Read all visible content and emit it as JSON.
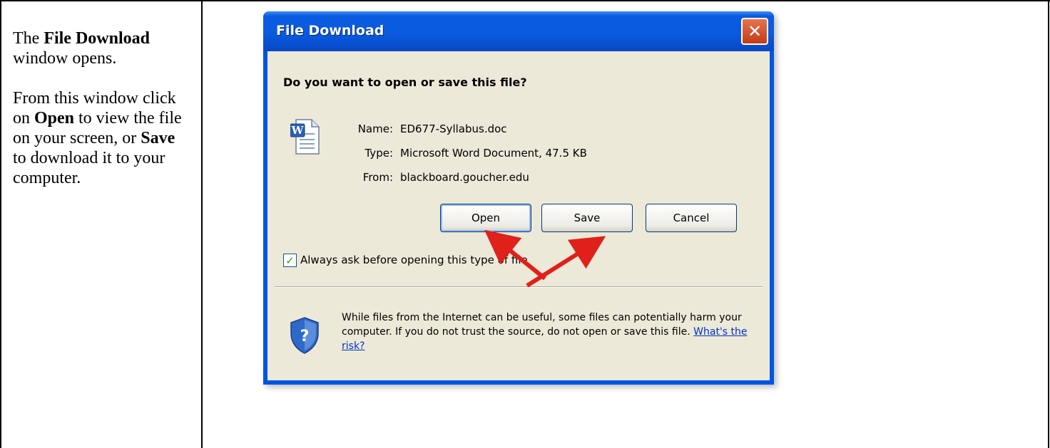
{
  "instructions": {
    "p1_prefix": "The ",
    "p1_bold": "File Download",
    "p1_suffix": " window opens.",
    "p2_prefix": "From this window click on ",
    "p2_bold1": "Open",
    "p2_mid": " to view the file on your screen, or ",
    "p2_bold2": "Save",
    "p2_suffix": " to download it to your computer."
  },
  "dialog": {
    "title": "File Download",
    "close_symbol": "✕",
    "question": "Do you want to open or save this file?",
    "name_label": "Name:",
    "name_value": "ED677-Syllabus.doc",
    "type_label": "Type:",
    "type_value": "Microsoft Word Document, 47.5 KB",
    "from_label": "From:",
    "from_value": "blackboard.goucher.edu",
    "open_label": "Open",
    "save_label": "Save",
    "cancel_label": "Cancel",
    "checkbox_checked": true,
    "checkbox_mark": "✓",
    "checkbox_label": "Always ask before opening this type of file",
    "warning_text": "While files from the Internet can be useful, some files can potentially harm your computer. If you do not trust the source, do not open or save this file. ",
    "risk_link": "What's the risk?",
    "file_icon": "word-document-icon",
    "warning_icon": "security-shield-question-icon"
  },
  "colors": {
    "title_bar": "#0a5be0",
    "client_bg": "#ece9d8",
    "close_button": "#d2532d",
    "arrow": "#e0201a",
    "link": "#0033cc"
  }
}
